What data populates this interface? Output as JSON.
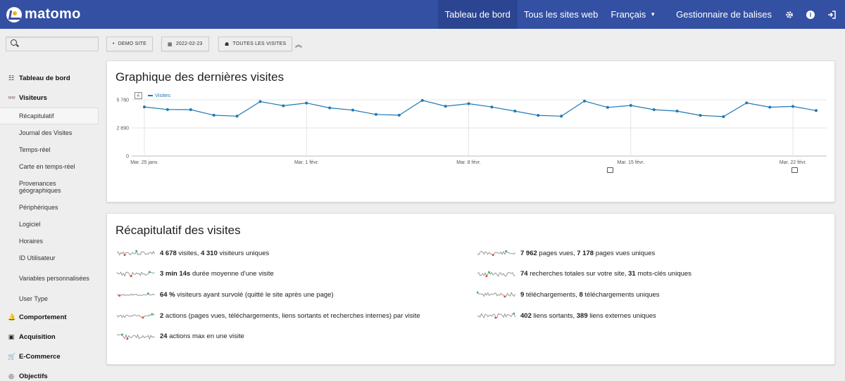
{
  "brand": {
    "name": "matomo"
  },
  "nav": {
    "items": [
      {
        "label": "Tableau de bord",
        "active": true
      },
      {
        "label": "Tous les sites web",
        "active": false
      },
      {
        "label": "Français",
        "active": false,
        "dropdown": true
      },
      {
        "label": "Gestionnaire de balises",
        "active": false
      }
    ],
    "icons": [
      "gear-icon",
      "info-icon",
      "sign-out-icon"
    ]
  },
  "search": {
    "placeholder": ""
  },
  "segment_bar": {
    "site": "DEMO SITE",
    "date": "2022-02-23",
    "segment": "TOUTES LES VISITES"
  },
  "sidebar": {
    "categories": [
      {
        "label": "Tableau de bord",
        "icon": "dashboard-icon"
      },
      {
        "label": "Visiteurs",
        "icon": "visitors-icon"
      },
      {
        "label": "Comportement",
        "icon": "behaviour-icon"
      },
      {
        "label": "Acquisition",
        "icon": "acquisition-icon"
      },
      {
        "label": "E-Commerce",
        "icon": "ecommerce-icon"
      },
      {
        "label": "Objectifs",
        "icon": "goals-icon"
      }
    ],
    "visitor_items": [
      "Récapitulatif",
      "Journal des Visites",
      "Temps-réel",
      "Carte en temps-réel",
      "Provenances géographiques",
      "Périphériques",
      "Logiciel",
      "Horaires",
      "ID Utilisateur",
      "Variables personnalisées",
      "User Type"
    ]
  },
  "graph_card": {
    "title": "Graphique des dernières visites"
  },
  "chart_data": {
    "type": "line",
    "title": "Graphique des dernières visites",
    "series": [
      {
        "name": "Visites",
        "color": "#1f78b4",
        "values": [
          5050,
          4780,
          4770,
          4200,
          4100,
          5600,
          5170,
          5450,
          4950,
          4720,
          4280,
          4200,
          5720,
          5120,
          5380,
          5040,
          4620,
          4180,
          4100,
          5650,
          5000,
          5200,
          4770,
          4620,
          4180,
          4050,
          5460,
          5020,
          5100,
          4678
        ]
      }
    ],
    "x_tick_labels": [
      "Mar. 25 janv.",
      "Mar. 1 févr.",
      "Mar. 8 févr.",
      "Mar. 15 févr.",
      "Mar. 22 févr."
    ],
    "y_tick_labels": [
      "0",
      "2 890",
      "5 780"
    ],
    "ylim": [
      0,
      5780
    ],
    "grid": true,
    "legend": "top-left"
  },
  "summary_card": {
    "title": "Récapitulatif des visites",
    "left": [
      {
        "parts": [
          [
            "b",
            "4 678"
          ],
          [
            "t",
            " visites, "
          ],
          [
            "b",
            "4 310"
          ],
          [
            "t",
            " visiteurs uniques"
          ]
        ]
      },
      {
        "parts": [
          [
            "b",
            "3 min 14s"
          ],
          [
            "t",
            " durée moyenne d'une visite"
          ]
        ]
      },
      {
        "parts": [
          [
            "b",
            "64 %"
          ],
          [
            "t",
            " visiteurs ayant survolé (quitté le site après une page)"
          ]
        ]
      },
      {
        "parts": [
          [
            "b",
            "2"
          ],
          [
            "t",
            " actions (pages vues, téléchargements, liens sortants et recherches internes) par visite"
          ]
        ]
      },
      {
        "parts": [
          [
            "b",
            "24"
          ],
          [
            "t",
            " actions max en une visite"
          ]
        ]
      }
    ],
    "right": [
      {
        "parts": [
          [
            "b",
            "7 962"
          ],
          [
            "t",
            " pages vues, "
          ],
          [
            "b",
            "7 178"
          ],
          [
            "t",
            " pages vues uniques"
          ]
        ]
      },
      {
        "parts": [
          [
            "b",
            "74"
          ],
          [
            "t",
            " recherches totales sur votre site, "
          ],
          [
            "b",
            "31"
          ],
          [
            "t",
            " mots-clés uniques"
          ]
        ]
      },
      {
        "parts": [
          [
            "b",
            "9"
          ],
          [
            "t",
            " téléchargements, "
          ],
          [
            "b",
            "8"
          ],
          [
            "t",
            " téléchargements uniques"
          ]
        ]
      },
      {
        "parts": [
          [
            "b",
            "402"
          ],
          [
            "t",
            " liens sortants, "
          ],
          [
            "b",
            "389"
          ],
          [
            "t",
            " liens externes uniques"
          ]
        ]
      }
    ]
  }
}
